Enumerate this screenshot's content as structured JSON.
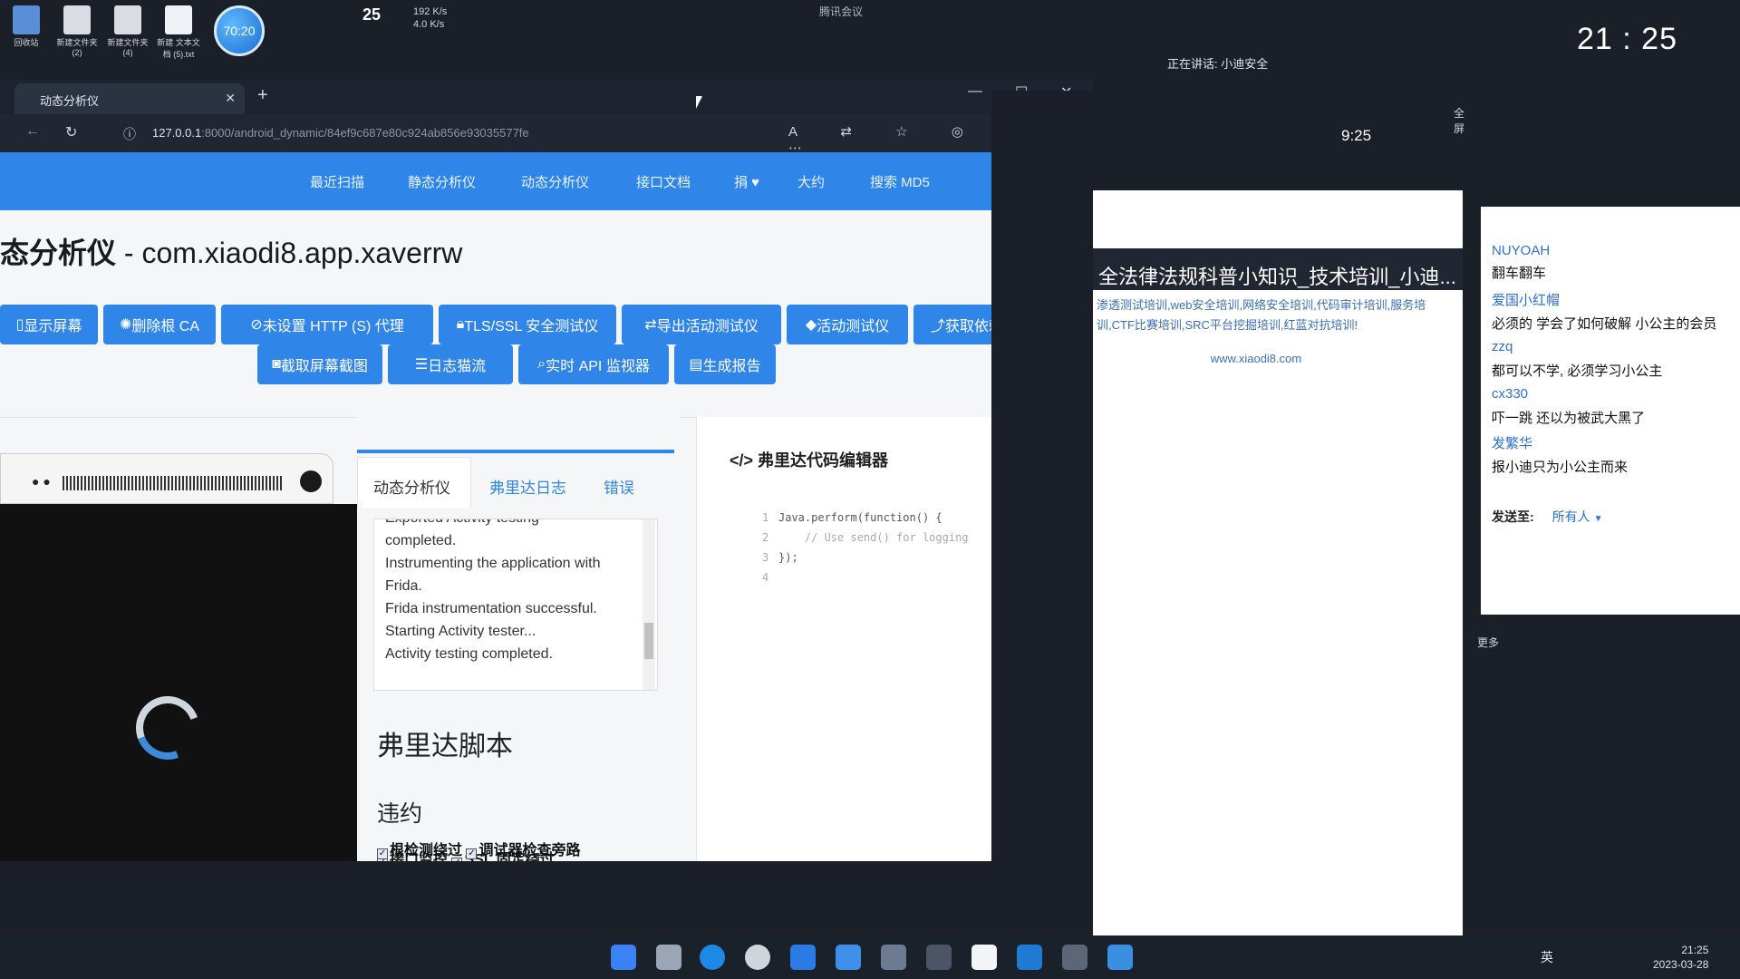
{
  "desktop": {
    "icons": [
      {
        "name": "recycle-bin",
        "label": "回收站"
      },
      {
        "name": "folder",
        "label": "新建文件夹 (2)"
      },
      {
        "name": "folder",
        "label": "新建文件夹 (4)"
      },
      {
        "name": "text-file",
        "label": "新建 文本文档 (5).txt"
      }
    ],
    "net_meter": "70:20",
    "temperature": "25",
    "upload_speed": "192 K/s",
    "download_speed": "4.0 K/s",
    "meeting_title": "腾讯会议",
    "speaking": "正在讲话: 小迪安全",
    "clock": "21 : 25",
    "colors": {
      "accent": "#2f86e8",
      "desktop": "#1b1f27"
    }
  },
  "browser": {
    "tab_title": "动态分析仪",
    "url_host": "127.0.0.1",
    "url_path": ":8000/android_dynamic/84ef9c687e80c924ab856e93035577fe",
    "nav": [
      "最近扫描",
      "静态分析仪",
      "动态分析仪",
      "接口文档",
      "捐 ♥",
      "大约",
      "搜索 MD5"
    ],
    "title_bold": "态分析仪",
    "title_pkg": "- com.xiaodi8.app.xaverrw",
    "buttons_row1": [
      "显示屏幕",
      "删除根 CA",
      "未设置 HTTP (S) 代理",
      "TLS/SSL 安全测试仪",
      "导出活动测试仪",
      "活动测试仪",
      "获取依赖项"
    ],
    "buttons_row2": [
      "截取屏幕截图",
      "日志猫流",
      "实时 API 监视器",
      "生成报告"
    ],
    "panel_tabs": [
      "动态分析仪",
      "弗里达日志",
      "错误"
    ],
    "log_lines": [
      "Exported Activity testing",
      "completed.",
      "Instrumenting the application with",
      "Frida.",
      "Frida instrumentation successful.",
      "Starting Activity tester...",
      "Activity testing completed."
    ],
    "frida_script_heading": "弗里达脚本",
    "bypass_heading": "违约",
    "checks_row1": [
      "接口监控",
      "SSL 固定绕过"
    ],
    "checks_row2": [
      "根检测绕过",
      "调试器检查旁路"
    ],
    "editor_title": "弗里达代码编辑器",
    "code_lines": [
      "Java.perform(function() {",
      "    // Use send() for logging",
      "});",
      ""
    ]
  },
  "video": {
    "title": "全法律法规科普小知识_技术培训_小迪...",
    "banner": "渗透测试培训,web安全培训,网络安全培训,代码审计培训,服务培训,CTF比赛培训,SRC平台挖掘培训,红蓝对抗培训!",
    "url": "www.xiaodi8.com",
    "phone_time": "9:25",
    "fullscreen": "全屏",
    "more": "更多"
  },
  "chat": {
    "messages": [
      {
        "name": "NUYOAH",
        "text": "翻车翻车"
      },
      {
        "name": "爱国小红帽",
        "text": "必须的 学会了如何破解 小公主的会员"
      },
      {
        "name": "zzq",
        "text": "都可以不学, 必须学习小公主"
      },
      {
        "name": "cx330",
        "text": "吓一跳 还以为被武大黑了"
      },
      {
        "name": "发繁华",
        "text": "报小迪只为小公主而来"
      }
    ],
    "send_to_label": "发送至:",
    "send_to_value": "所有人"
  },
  "taskbar": {
    "lang": "英",
    "time": "21:25",
    "date": "2023-03-28"
  }
}
